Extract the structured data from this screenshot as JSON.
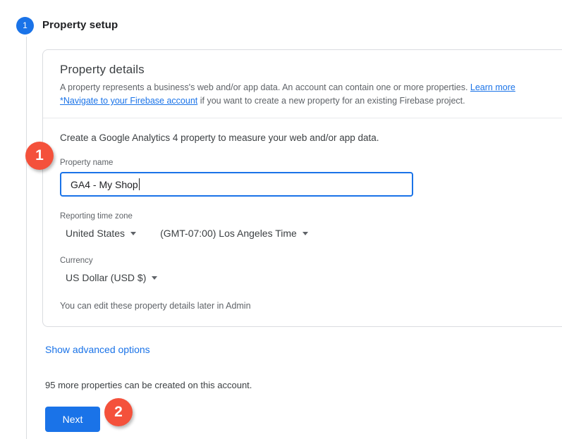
{
  "stepper": {
    "step_number": "1",
    "step_title": "Property setup"
  },
  "card": {
    "title": "Property details",
    "description_part1": "A property represents a business's web and/or app data. An account can contain one or more properties. ",
    "learn_more_link": "Learn more",
    "firebase_link": "*Navigate to your Firebase account",
    "description_part2": " if you want to create a new property for an existing Firebase project.",
    "intro": "Create a Google Analytics 4 property to measure your web and/or app data.",
    "fields": {
      "property_name_label": "Property name",
      "property_name_value": "GA4 - My Shop",
      "property_name_placeholder": "Property name",
      "time_zone_label": "Reporting time zone",
      "time_zone_country": "United States",
      "time_zone_value": "(GMT-07:00) Los Angeles Time",
      "currency_label": "Currency",
      "currency_value": "US Dollar (USD $)"
    },
    "footer_note": "You can edit these property details later in Admin"
  },
  "below_card": {
    "advanced_options_link": "Show advanced options",
    "quota_text": "95 more properties can be created on this account.",
    "next_button": "Next"
  },
  "annotations": {
    "badge_1": "1",
    "badge_2": "2"
  },
  "colors": {
    "accent_blue": "#1a73e8",
    "badge_coral": "#f4513b",
    "border_gray": "#dadce0",
    "text_primary": "#202124",
    "text_secondary": "#5f6368"
  }
}
